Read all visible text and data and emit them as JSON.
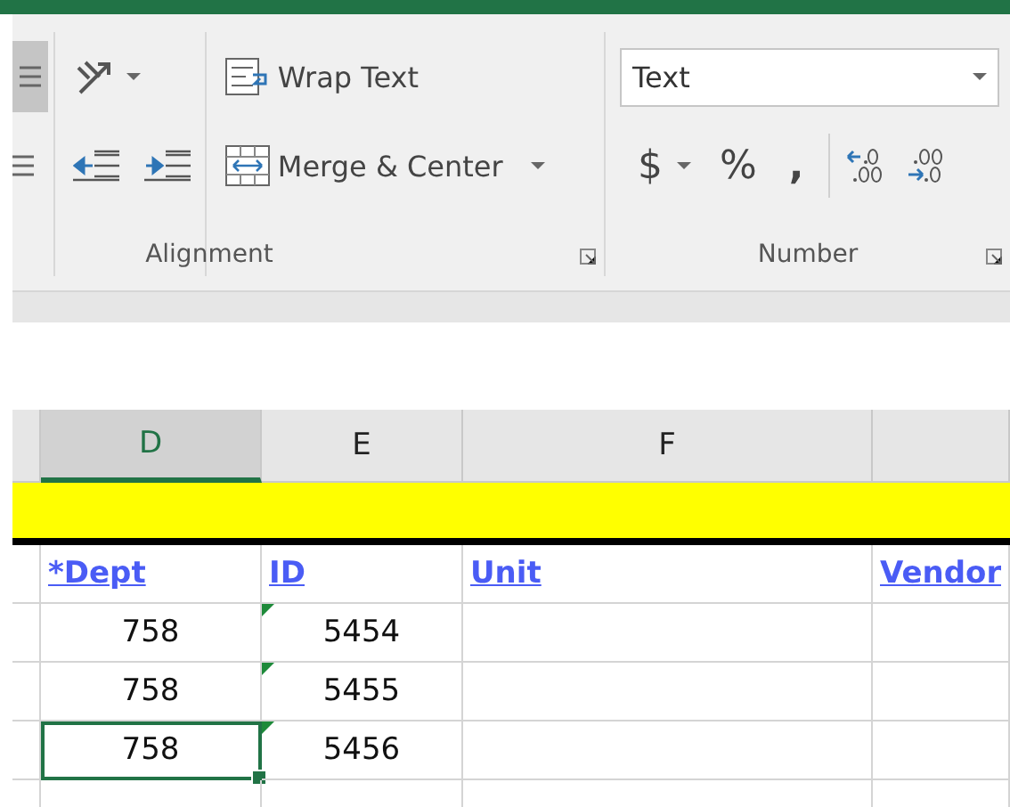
{
  "ribbon": {
    "alignment": {
      "wrap_text": "Wrap Text",
      "merge_center": "Merge & Center",
      "label": "Alignment",
      "left_button_selected": true
    },
    "number": {
      "format": "Text",
      "currency": "$",
      "percent": "%",
      "comma": ",",
      "label": "Number"
    }
  },
  "sheet": {
    "columns": [
      {
        "letter": "D",
        "selected": true
      },
      {
        "letter": "E",
        "selected": false
      },
      {
        "letter": "F",
        "selected": false
      },
      {
        "selected": false
      }
    ],
    "headers": [
      "*Dept",
      "ID",
      "Unit",
      "Vendor"
    ],
    "rows": [
      {
        "cells": [
          {
            "value": "758",
            "selected": false,
            "flagged": false
          },
          {
            "value": "5454",
            "selected": false,
            "flagged": true
          },
          {
            "selected": false,
            "flagged": false
          },
          {
            "selected": false,
            "flagged": false
          }
        ]
      },
      {
        "cells": [
          {
            "value": "758",
            "selected": false,
            "flagged": false
          },
          {
            "value": "5455",
            "selected": false,
            "flagged": true
          },
          {
            "selected": false,
            "flagged": false
          },
          {
            "selected": false,
            "flagged": false
          }
        ]
      },
      {
        "cells": [
          {
            "value": "758",
            "selected": true,
            "flagged": false
          },
          {
            "value": "5456",
            "selected": false,
            "flagged": true
          },
          {
            "selected": false,
            "flagged": false
          },
          {
            "selected": false,
            "flagged": false
          }
        ]
      }
    ]
  }
}
